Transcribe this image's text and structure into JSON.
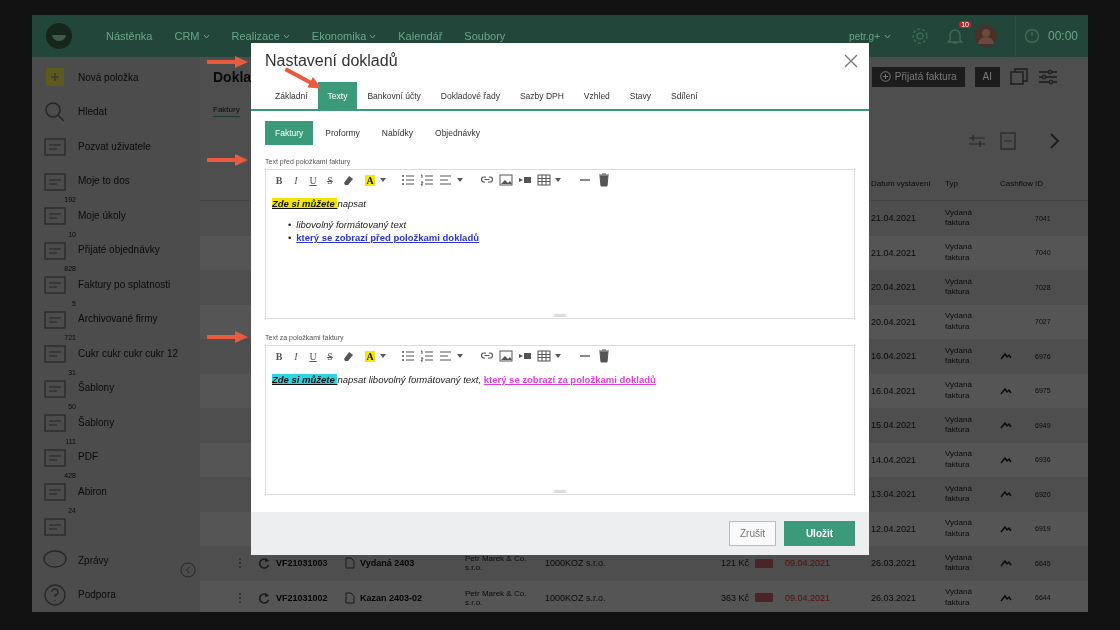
{
  "nav": {
    "items": [
      {
        "label": "Nástěnka",
        "dropdown": false
      },
      {
        "label": "CRM",
        "dropdown": true
      },
      {
        "label": "Realizace",
        "dropdown": true
      },
      {
        "label": "Ekonomika",
        "dropdown": true
      },
      {
        "label": "Kalendář",
        "dropdown": false
      },
      {
        "label": "Soubory",
        "dropdown": false
      }
    ],
    "user": "petr.g+",
    "notifications": "10",
    "timer": "00:00"
  },
  "sidebar": {
    "items": [
      {
        "label": "Nová položka",
        "kind": "new"
      },
      {
        "label": "Hledat",
        "kind": "search"
      },
      {
        "label": "Pozvat uživatele",
        "kind": "doc"
      },
      {
        "label": "Moje to dos",
        "kind": "doc"
      },
      {
        "label": "Moje úkoly",
        "kind": "doc",
        "count": "192"
      },
      {
        "label": "Přijaté objednávky",
        "kind": "doc",
        "count": "10"
      },
      {
        "label": "Faktury po splatnosti",
        "kind": "doc",
        "count": "828"
      },
      {
        "label": "Archivované firmy",
        "kind": "doc",
        "count": "5"
      },
      {
        "label": "Cukr cukr cukr cukr 12",
        "kind": "doc",
        "count": "721"
      },
      {
        "label": "Šablony",
        "kind": "doc",
        "count": "31"
      },
      {
        "label": "Šablony",
        "kind": "doc",
        "count": "50"
      },
      {
        "label": "PDF",
        "kind": "doc",
        "count": "111"
      },
      {
        "label": "Abiron",
        "kind": "doc",
        "count": "428"
      },
      {
        "kind": "doc",
        "count": "24"
      },
      {
        "label": "Zprávy",
        "kind": "chat"
      },
      {
        "label": "Podpora",
        "kind": "help"
      }
    ]
  },
  "page": {
    "title": "Dokla",
    "tabs": [
      {
        "label": "Faktury",
        "selected": true
      }
    ],
    "buttons": [
      {
        "label": "Přijatá faktura",
        "kind": "add"
      },
      {
        "label": "AI",
        "kind": "plain"
      }
    ]
  },
  "table": {
    "columns": [
      "Datum vystavení",
      "Typ",
      "Cashflow",
      "ID"
    ],
    "rows": [
      {
        "date": "21.04.2021",
        "type": "Vydaná faktura",
        "cashflow": false,
        "id": "7041"
      },
      {
        "date": "21.04.2021",
        "type": "Vydaná faktura",
        "cashflow": false,
        "id": "7040"
      },
      {
        "date": "20.04.2021",
        "type": "Vydaná faktura",
        "cashflow": false,
        "id": "7028"
      },
      {
        "date": "20.04.2021",
        "type": "Vydaná faktura",
        "cashflow": false,
        "id": "7027"
      },
      {
        "date": "16.04.2021",
        "type": "Vydaná faktura",
        "cashflow": true,
        "id": "6976"
      },
      {
        "date": "16.04.2021",
        "type": "Vydaná faktura",
        "cashflow": true,
        "id": "6975"
      },
      {
        "date": "15.04.2021",
        "type": "Vydaná faktura",
        "cashflow": true,
        "id": "6949"
      },
      {
        "date": "14.04.2021",
        "type": "Vydaná faktura",
        "cashflow": true,
        "id": "6936"
      },
      {
        "date": "13.04.2021",
        "type": "Vydaná faktura",
        "cashflow": true,
        "id": "6920"
      },
      {
        "date": "12.04.2021",
        "type": "Vydaná faktura",
        "cashflow": true,
        "id": "6919"
      },
      {
        "number": "VF21031003",
        "name": "Vydaná 2403",
        "company": "Petr Marek & Co. s.r.o.",
        "client": "1000KOZ s.r.o.",
        "amount": "121 Kč",
        "due": "09.04.2021",
        "overdue": true,
        "date": "26.03.2021",
        "type": "Vydaná faktura",
        "cashflow": true,
        "id": "6645"
      },
      {
        "number": "VF21031002",
        "name": "Kazan 2403-02",
        "company": "Petr Marek & Co. s.r.o.",
        "client": "1000KOZ s.r.o.",
        "amount": "363 Kč",
        "due": "09.04.2021",
        "overdue": true,
        "date": "26.03.2021",
        "type": "Vydaná faktura",
        "cashflow": true,
        "id": "6644"
      }
    ]
  },
  "modal": {
    "title": "Nastavení dokladů",
    "tabs": [
      {
        "label": "Základní",
        "selected": false
      },
      {
        "label": "Texty",
        "selected": true
      },
      {
        "label": "Bankovní účty",
        "selected": false
      },
      {
        "label": "Dokladové řady",
        "selected": false
      },
      {
        "label": "Sazby DPH",
        "selected": false
      },
      {
        "label": "Vzhled",
        "selected": false
      },
      {
        "label": "Stavy",
        "selected": false
      },
      {
        "label": "Sdílení",
        "selected": false
      }
    ],
    "subtabs": [
      {
        "label": "Faktury",
        "selected": true
      },
      {
        "label": "Proformy",
        "selected": false
      },
      {
        "label": "Nabídky",
        "selected": false
      },
      {
        "label": "Objednávky",
        "selected": false
      }
    ],
    "editors": [
      {
        "label": "Text před položkami faktury",
        "toolbar": [
          {
            "kind": "bold",
            "text": "B"
          },
          {
            "kind": "italic",
            "text": "I"
          },
          {
            "kind": "underline",
            "text": "U"
          },
          {
            "kind": "strike",
            "text": "S"
          },
          {
            "kind": "eraser"
          },
          {
            "kind": "color",
            "text": "A"
          },
          {
            "kind": "ul"
          },
          {
            "kind": "ol"
          },
          {
            "kind": "align"
          },
          {
            "kind": "link"
          },
          {
            "kind": "image"
          },
          {
            "kind": "video"
          },
          {
            "kind": "table"
          },
          {
            "kind": "hr"
          },
          {
            "kind": "trash"
          }
        ],
        "blocks": [
          {
            "kind": "paragraph",
            "segments": [
              {
                "kind": "highlight",
                "text": "Zde si můžete ",
                "color": "#f2e600"
              },
              {
                "kind": "italic",
                "text": "napsat"
              }
            ]
          },
          {
            "kind": "list",
            "marker": "•",
            "items": [
              [
                {
                  "kind": "italic",
                  "text": "libovolný formátovaný text"
                }
              ],
              [
                {
                  "kind": "link",
                  "text": "který se zobrazí před položkami dokladů",
                  "color": "#2a35d8"
                }
              ]
            ]
          }
        ]
      },
      {
        "label": "Text za položkami faktury",
        "toolbar": [
          {
            "kind": "bold",
            "text": "B"
          },
          {
            "kind": "italic",
            "text": "I"
          },
          {
            "kind": "underline",
            "text": "U"
          },
          {
            "kind": "strike",
            "text": "S"
          },
          {
            "kind": "eraser"
          },
          {
            "kind": "color",
            "text": "A"
          },
          {
            "kind": "ul"
          },
          {
            "kind": "ol"
          },
          {
            "kind": "align"
          },
          {
            "kind": "link"
          },
          {
            "kind": "image"
          },
          {
            "kind": "video"
          },
          {
            "kind": "table"
          },
          {
            "kind": "hr"
          },
          {
            "kind": "trash"
          }
        ],
        "blocks": [
          {
            "kind": "paragraph",
            "segments": [
              {
                "kind": "highlight",
                "text": "Zde si můžete ",
                "color": "#2fd3e0"
              },
              {
                "kind": "italic",
                "text": "napsat libovolný formátovaný text, "
              },
              {
                "kind": "link",
                "text": "který se zobrazí za položkami dokladů",
                "color": "#e03ee0"
              }
            ]
          }
        ]
      }
    ],
    "buttons": [
      {
        "label": "Zrušit",
        "kind": "secondary"
      },
      {
        "label": "Uložit",
        "kind": "primary"
      }
    ]
  }
}
